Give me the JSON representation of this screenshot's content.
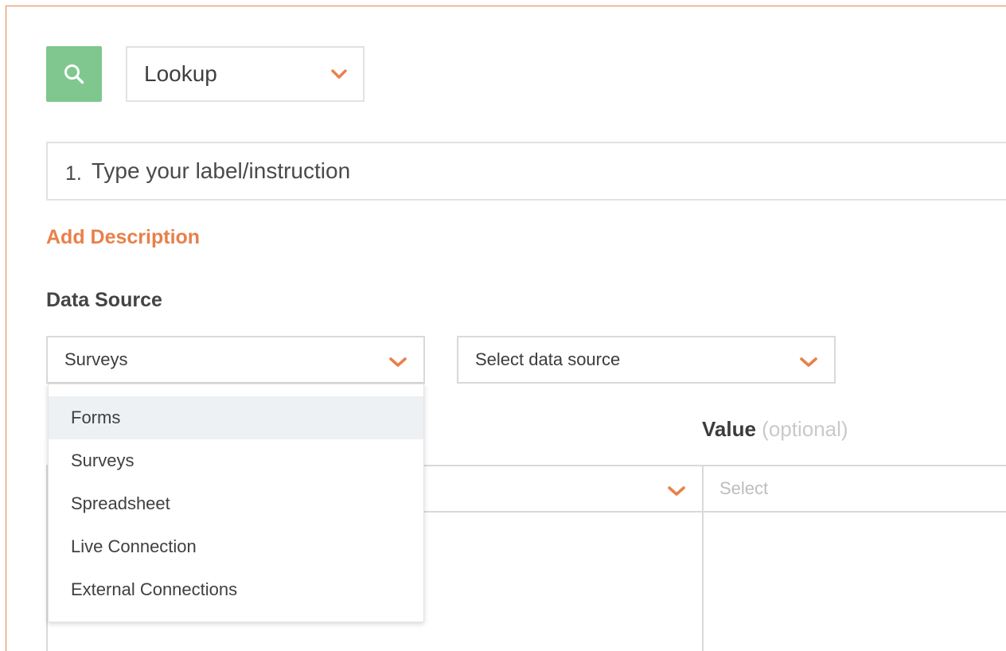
{
  "colors": {
    "accent": "#e8804a",
    "search_button_bg": "#7fc78e",
    "highlight_bg": "#eef1f3",
    "border": "#d9d9d9"
  },
  "toolbar": {
    "search_icon": "search-icon",
    "question_type": "Lookup"
  },
  "question": {
    "number": "1.",
    "label": "Type your label/instruction"
  },
  "add_description": "Add Description",
  "data_source": {
    "heading": "Data Source",
    "source_type": {
      "value": "Surveys",
      "options": [
        "Forms",
        "Surveys",
        "Spreadsheet",
        "Live Connection",
        "External Connections"
      ],
      "highlighted": "Forms"
    },
    "source_select": {
      "value": "Select data source"
    }
  },
  "mapping": {
    "value_label": "Value",
    "optional_label": "(optional)",
    "value_placeholder": "Select"
  }
}
